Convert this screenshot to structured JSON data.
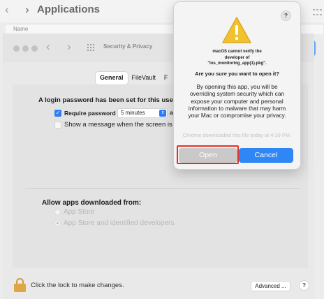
{
  "finder": {
    "back_glyph": "‹",
    "forward_glyph": "›",
    "title": "Applications",
    "column_name": "Name"
  },
  "security_window": {
    "title": "Security & Privacy",
    "tabs": [
      {
        "label": "General",
        "active": true
      },
      {
        "label": "FileVault",
        "active": false
      },
      {
        "label": "F",
        "active": false
      }
    ],
    "login_text": "A login password has been set for this user",
    "require_password_label": "Require password",
    "require_password_checked": true,
    "require_password_delay": "5 minutes",
    "after_sleep_text": "a",
    "show_message_label": "Show a message when the screen is",
    "show_message_checked": false,
    "allow_title": "Allow apps downloaded from:",
    "allow_options": [
      {
        "label": "App Store",
        "selected": false
      },
      {
        "label": "App Store and identified developers",
        "selected": true
      }
    ],
    "lock_text": "Click the lock to make changes.",
    "advanced_label": "Advanced ...",
    "help_glyph": "?"
  },
  "dialog": {
    "help_glyph": "?",
    "message_lines": [
      "macOS cannot verify the",
      "developer of",
      "\"ios_monitoring_app(1).pkg\"."
    ],
    "question": "Are you sure you want to open it?",
    "body": "By opening this app, you will be overriding system security which can expose your computer and personal information to malware that may harm your Mac or compromise your privacy.",
    "note": "Chrome downloaded this file today at 4:39 PM.",
    "open_label": "Open",
    "cancel_label": "Cancel"
  },
  "colors": {
    "accent": "#2f86f5",
    "highlight": "#e0312b",
    "warning": "#f2c12e"
  },
  "icons": [
    "chevron-left-icon",
    "chevron-right-icon",
    "grid-icon",
    "warning-icon",
    "lock-icon",
    "help-icon"
  ]
}
